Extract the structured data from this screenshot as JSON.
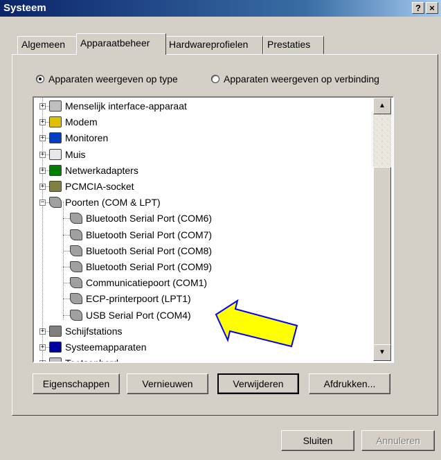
{
  "window": {
    "title": "Systeem",
    "help_label": "?",
    "close_label": "×"
  },
  "tabs": [
    {
      "label": "Algemeen"
    },
    {
      "label": "Apparaatbeheer"
    },
    {
      "label": "Hardwareprofielen"
    },
    {
      "label": "Prestaties"
    }
  ],
  "view_options": [
    {
      "label": "Apparaten weergeven op type",
      "selected": true
    },
    {
      "label": "Apparaten weergeven op verbinding",
      "selected": false
    }
  ],
  "tree": {
    "items": [
      {
        "label": "Menselijk interface-apparaat",
        "icon": "keyboard-device-icon"
      },
      {
        "label": "Modem",
        "icon": "modem-icon"
      },
      {
        "label": "Monitoren",
        "icon": "monitor-icon"
      },
      {
        "label": "Muis",
        "icon": "mouse-icon"
      },
      {
        "label": "Netwerkadapters",
        "icon": "network-adapter-icon"
      },
      {
        "label": "PCMCIA-socket",
        "icon": "pcmcia-icon"
      },
      {
        "label": "Poorten (COM & LPT)",
        "icon": "port-icon",
        "expanded": true
      },
      {
        "label": "Bluetooth Serial Port (COM6)",
        "icon": "port-icon"
      },
      {
        "label": "Bluetooth Serial Port (COM7)",
        "icon": "port-icon"
      },
      {
        "label": "Bluetooth Serial Port (COM8)",
        "icon": "port-icon"
      },
      {
        "label": "Bluetooth Serial Port (COM9)",
        "icon": "port-icon"
      },
      {
        "label": "Communicatiepoort (COM1)",
        "icon": "port-icon"
      },
      {
        "label": "ECP-printerpoort (LPT1)",
        "icon": "port-icon"
      },
      {
        "label": "USB Serial Port (COM4)",
        "icon": "port-icon",
        "highlighted": true
      },
      {
        "label": "Schijfstations",
        "icon": "disk-drive-icon"
      },
      {
        "label": "Systeemapparaten",
        "icon": "system-device-icon"
      },
      {
        "label": "Toetsenbord",
        "icon": "keyboard-icon"
      }
    ]
  },
  "buttons": {
    "properties": "Eigenschappen",
    "refresh": "Vernieuwen",
    "remove": "Verwijderen",
    "print": "Afdrukken...",
    "close": "Sluiten",
    "cancel": "Annuleren"
  },
  "colors": {
    "titlebar": "#0a246a",
    "face": "#d4d0c8",
    "arrow": "#ffff00",
    "arrow_outline": "#0000ff"
  }
}
